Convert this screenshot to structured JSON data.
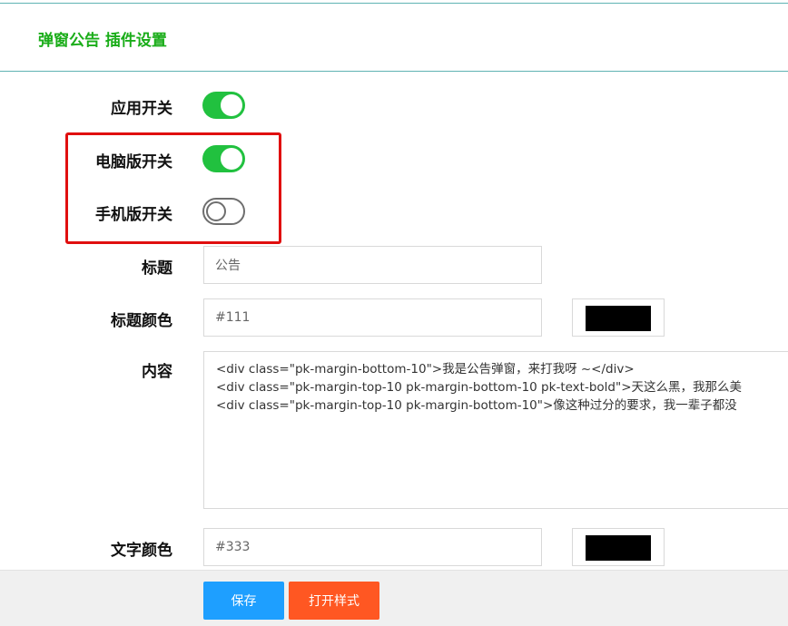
{
  "header": {
    "title": "弹窗公告 插件设置"
  },
  "settings": {
    "app_switch": {
      "label": "应用开关",
      "state": "on"
    },
    "pc_switch": {
      "label": "电脑版开关",
      "state": "on"
    },
    "mobile_switch": {
      "label": "手机版开关",
      "state": "off"
    },
    "title": {
      "label": "标题",
      "value": "公告"
    },
    "title_color": {
      "label": "标题颜色",
      "value": "#111",
      "swatch": "#000000"
    },
    "content": {
      "label": "内容",
      "lines": [
        "<div  class=\"pk-margin-bottom-10\">我是公告弹窗，来打我呀 ~</div>",
        "<div  class=\"pk-margin-top-10 pk-margin-bottom-10 pk-text-bold\">天这么黑，我那么美",
        "<div  class=\"pk-margin-top-10 pk-margin-bottom-10\">像这种过分的要求，我一辈子都没"
      ]
    },
    "text_color": {
      "label": "文字颜色",
      "value": "#333",
      "swatch": "#000000"
    }
  },
  "footer": {
    "save_label": "保存",
    "open_style_label": "打开样式"
  },
  "colors": {
    "accent": "#1aad19",
    "toggle_on": "#21c13f",
    "highlight": "#e00f0f",
    "save": "#1e9fff",
    "open_style": "#ff5722"
  }
}
